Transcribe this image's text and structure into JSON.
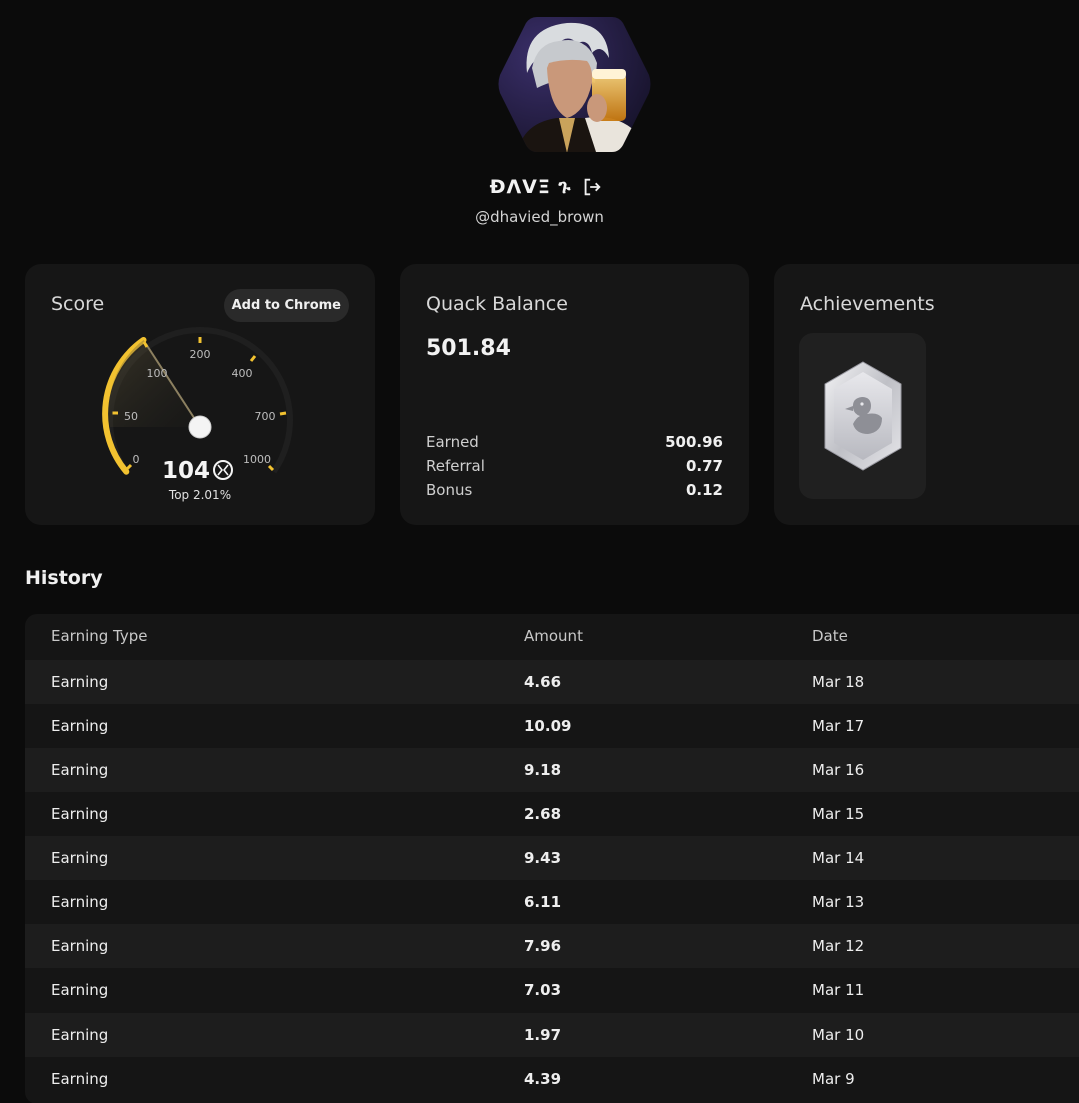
{
  "profile": {
    "name": "ĐΛVΞ ጉ",
    "handle": "@dhavied_brown",
    "avatar_icon": "avatar-hexagon"
  },
  "score": {
    "title": "Score",
    "add_chrome_label": "Add to Chrome",
    "value": "104",
    "rank": "Top 2.01%",
    "gauge_ticks": [
      "0",
      "50",
      "100",
      "200",
      "400",
      "700",
      "1000"
    ]
  },
  "balance": {
    "title": "Quack Balance",
    "total": "501.84",
    "rows": [
      {
        "label": "Earned",
        "value": "500.96"
      },
      {
        "label": "Referral",
        "value": "0.77"
      },
      {
        "label": "Bonus",
        "value": "0.12"
      }
    ]
  },
  "achievements": {
    "title": "Achievements",
    "badges": [
      {
        "icon": "duck-hexagon-badge-icon"
      }
    ]
  },
  "history": {
    "title": "History",
    "columns": [
      "Earning Type",
      "Amount",
      "Date"
    ],
    "rows": [
      {
        "type": "Earning",
        "amount": "4.66",
        "date": "Mar 18"
      },
      {
        "type": "Earning",
        "amount": "10.09",
        "date": "Mar 17"
      },
      {
        "type": "Earning",
        "amount": "9.18",
        "date": "Mar 16"
      },
      {
        "type": "Earning",
        "amount": "2.68",
        "date": "Mar 15"
      },
      {
        "type": "Earning",
        "amount": "9.43",
        "date": "Mar 14"
      },
      {
        "type": "Earning",
        "amount": "6.11",
        "date": "Mar 13"
      },
      {
        "type": "Earning",
        "amount": "7.96",
        "date": "Mar 12"
      },
      {
        "type": "Earning",
        "amount": "7.03",
        "date": "Mar 11"
      },
      {
        "type": "Earning",
        "amount": "1.97",
        "date": "Mar 10"
      },
      {
        "type": "Earning",
        "amount": "4.39",
        "date": "Mar 9"
      }
    ]
  },
  "colors": {
    "background": "#0b0b0b",
    "card": "#161616",
    "accent_gauge": "#f2c230"
  }
}
